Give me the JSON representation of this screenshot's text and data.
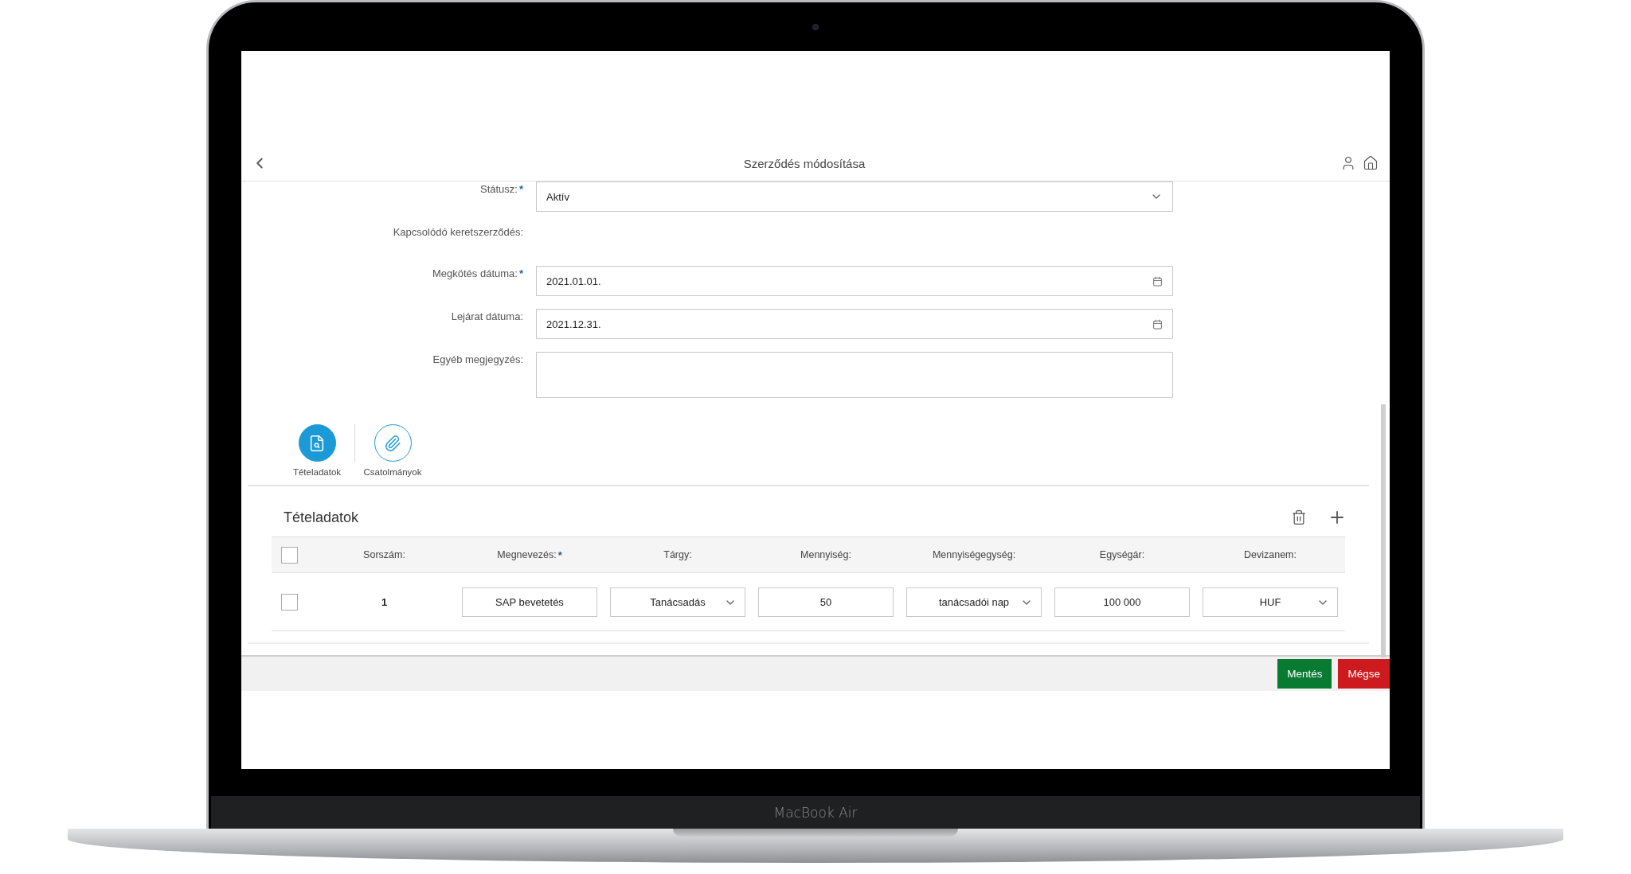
{
  "header": {
    "title": "Szerződés módosítása"
  },
  "form": {
    "fields": [
      {
        "label": "Státusz:",
        "required_mark": "*",
        "kind": "select",
        "value": "Aktív"
      },
      {
        "label": "Kapcsolódó keretszerződés:",
        "kind": "none"
      },
      {
        "label": "Megkötés dátuma:",
        "required_mark": "*",
        "kind": "date",
        "value": "2021.01.01."
      },
      {
        "label": "Lejárat dátuma:",
        "kind": "date",
        "value": "2021.12.31."
      },
      {
        "label": "Egyéb megjegyzés:",
        "kind": "textarea"
      }
    ]
  },
  "sections": [
    {
      "label": "Tételadatok",
      "selected": true
    },
    {
      "label": "Csatolmányok",
      "selected": false
    }
  ],
  "items": {
    "title": "Tételadatok",
    "all_checked": false,
    "columns": [
      {
        "label": "Sorszám:"
      },
      {
        "label": "Megnevezés:",
        "required_mark": "*"
      },
      {
        "label": "Tárgy:"
      },
      {
        "label": "Mennyiség:"
      },
      {
        "label": "Mennyiségegység:"
      },
      {
        "label": "Egységár:"
      },
      {
        "label": "Devizanem:"
      }
    ],
    "rows": [
      {
        "checked": false,
        "cells": [
          {
            "kind": "text",
            "value": "1"
          },
          {
            "kind": "input",
            "value": "SAP bevetetés"
          },
          {
            "kind": "select",
            "value": "Tanácsadás"
          },
          {
            "kind": "input",
            "value": "50"
          },
          {
            "kind": "select",
            "value": "tanácsadói nap"
          },
          {
            "kind": "input",
            "value": "100 000"
          },
          {
            "kind": "select",
            "value": "HUF"
          }
        ]
      }
    ]
  },
  "footer": {
    "buttons": [
      {
        "label": "Mentés",
        "kind": "primary"
      },
      {
        "label": "Mégse",
        "kind": "danger"
      }
    ]
  },
  "device": {
    "brand_label": "MacBook Air"
  }
}
